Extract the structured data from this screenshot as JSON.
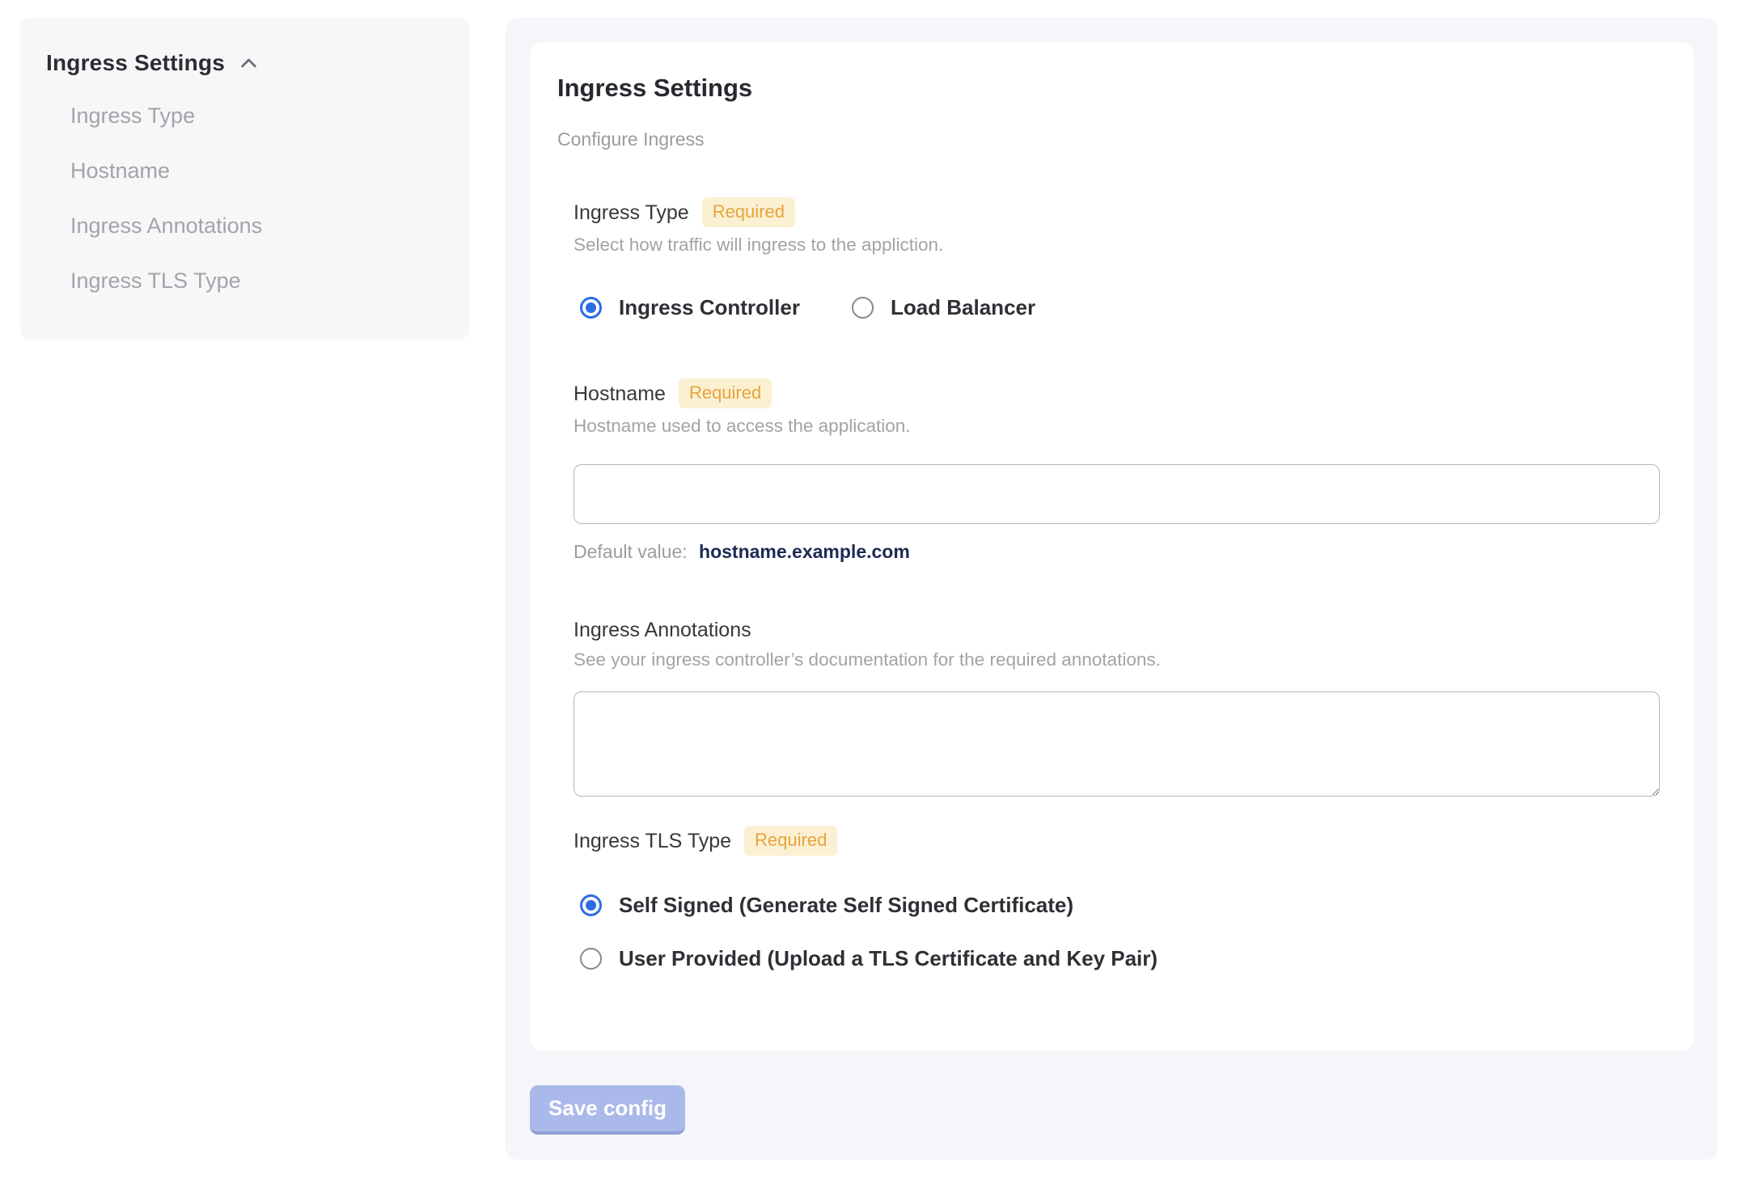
{
  "sidebar": {
    "header": "Ingress Settings",
    "collapse_icon": "chevron-up",
    "items": [
      {
        "label": "Ingress Type"
      },
      {
        "label": "Hostname"
      },
      {
        "label": "Ingress Annotations"
      },
      {
        "label": "Ingress TLS Type"
      }
    ]
  },
  "main": {
    "title": "Ingress Settings",
    "subtitle": "Configure Ingress",
    "fields": {
      "ingress_type": {
        "label": "Ingress Type",
        "badge": "Required",
        "help": "Select how traffic will ingress to the appliction.",
        "options": [
          {
            "label": "Ingress Controller",
            "selected": true
          },
          {
            "label": "Load Balancer",
            "selected": false
          }
        ]
      },
      "hostname": {
        "label": "Hostname",
        "badge": "Required",
        "help": "Hostname used to access the application.",
        "value": "",
        "default_prefix": "Default value:",
        "default_value": "hostname.example.com"
      },
      "annotations": {
        "label": "Ingress Annotations",
        "help": "See your ingress controller’s documentation for the required annotations.",
        "value": ""
      },
      "tls_type": {
        "label": "Ingress TLS Type",
        "badge": "Required",
        "options": [
          {
            "label": "Self Signed (Generate Self Signed Certificate)",
            "selected": true
          },
          {
            "label": "User Provided (Upload a TLS Certificate and Key Pair)",
            "selected": false
          }
        ]
      }
    },
    "save_button": "Save config"
  },
  "colors": {
    "accent_blue": "#2d6ce3",
    "badge_bg": "#fcf0d2",
    "badge_text": "#e7a33c",
    "default_value_navy": "#1c2a53",
    "save_button_bg": "#abb9ea",
    "panel_bg": "#f5f6f9",
    "sidebar_bg": "#f6f7f8"
  }
}
